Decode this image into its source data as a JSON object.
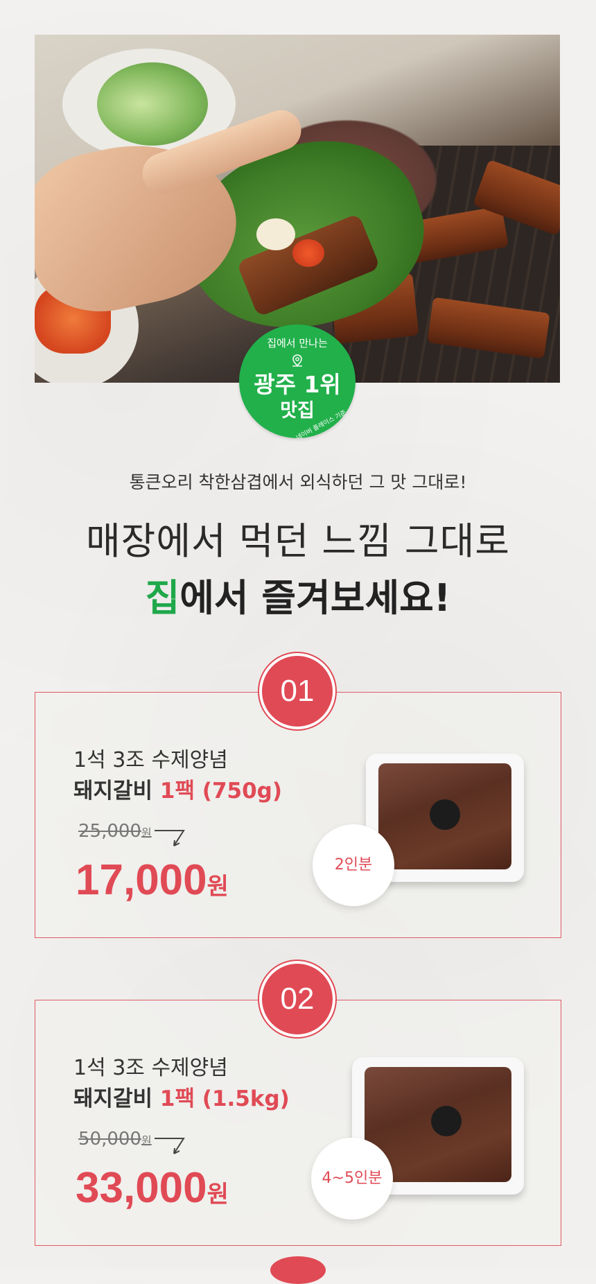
{
  "hero": {
    "badge": {
      "arc_text": "집에서 만나는",
      "main": "광주 1위",
      "sub": "맛집",
      "note": "네이버 플레이스 기준"
    }
  },
  "subtitle": "통큰오리 착한삼겹에서 외식하던 그 맛 그대로!",
  "headline": {
    "line1": "매장에서 먹던 느낌 그대로",
    "line2_green": "집",
    "line2_rest": "에서 즐겨보세요!"
  },
  "products": [
    {
      "number": "01",
      "line1": "1석 3조 수제양념",
      "name": "돼지갈비",
      "pack": "1팩 (750g)",
      "old_price": "25,000",
      "old_unit": "원",
      "new_price": "17,000",
      "new_unit": "원",
      "servings": "2인분"
    },
    {
      "number": "02",
      "line1": "1석 3조 수제양념",
      "name": "돼지갈비",
      "pack": "1팩 (1.5kg)",
      "old_price": "50,000",
      "old_unit": "원",
      "new_price": "33,000",
      "new_unit": "원",
      "servings": "4~5인분"
    }
  ],
  "colors": {
    "accent_red": "#e04a55",
    "accent_green": "#1fa84a"
  }
}
